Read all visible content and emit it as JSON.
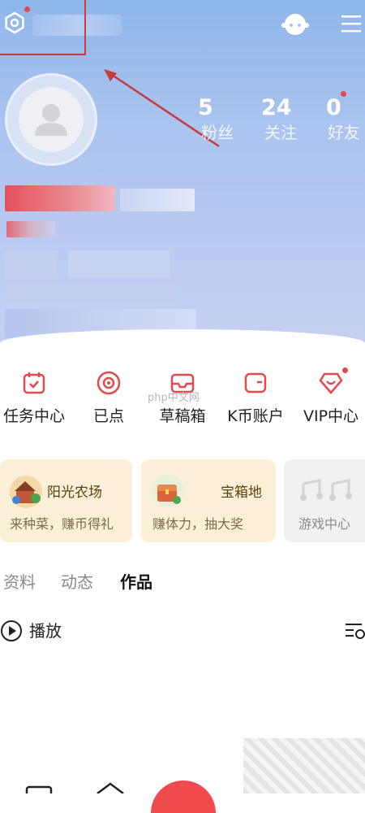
{
  "stats": [
    {
      "value": "5",
      "label": "粉丝"
    },
    {
      "value": "24",
      "label": "关注"
    },
    {
      "value": "0",
      "label": "好友"
    }
  ],
  "shortcuts": [
    {
      "label": "任务中心",
      "icon": "calendar-check-icon"
    },
    {
      "label": "已点",
      "icon": "disc-icon"
    },
    {
      "label": "草稿箱",
      "icon": "inbox-icon"
    },
    {
      "label": "K币账户",
      "icon": "wallet-icon"
    },
    {
      "label": "VIP中心",
      "icon": "diamond-heart-icon"
    }
  ],
  "cards": [
    {
      "title": "阳光农场",
      "subtitle": "来种菜，赚币得礼"
    },
    {
      "title": "宝箱地",
      "subtitle": "赚体力，抽大奖"
    },
    {
      "title": "",
      "subtitle": "游戏中心"
    }
  ],
  "tabs": [
    "资料",
    "动态",
    "作品"
  ],
  "play_label": "播放",
  "watermark": "php中文网",
  "colors": {
    "accent": "#e5484d",
    "highlight_box": "#d53838",
    "hero": "#a9c4ef"
  }
}
